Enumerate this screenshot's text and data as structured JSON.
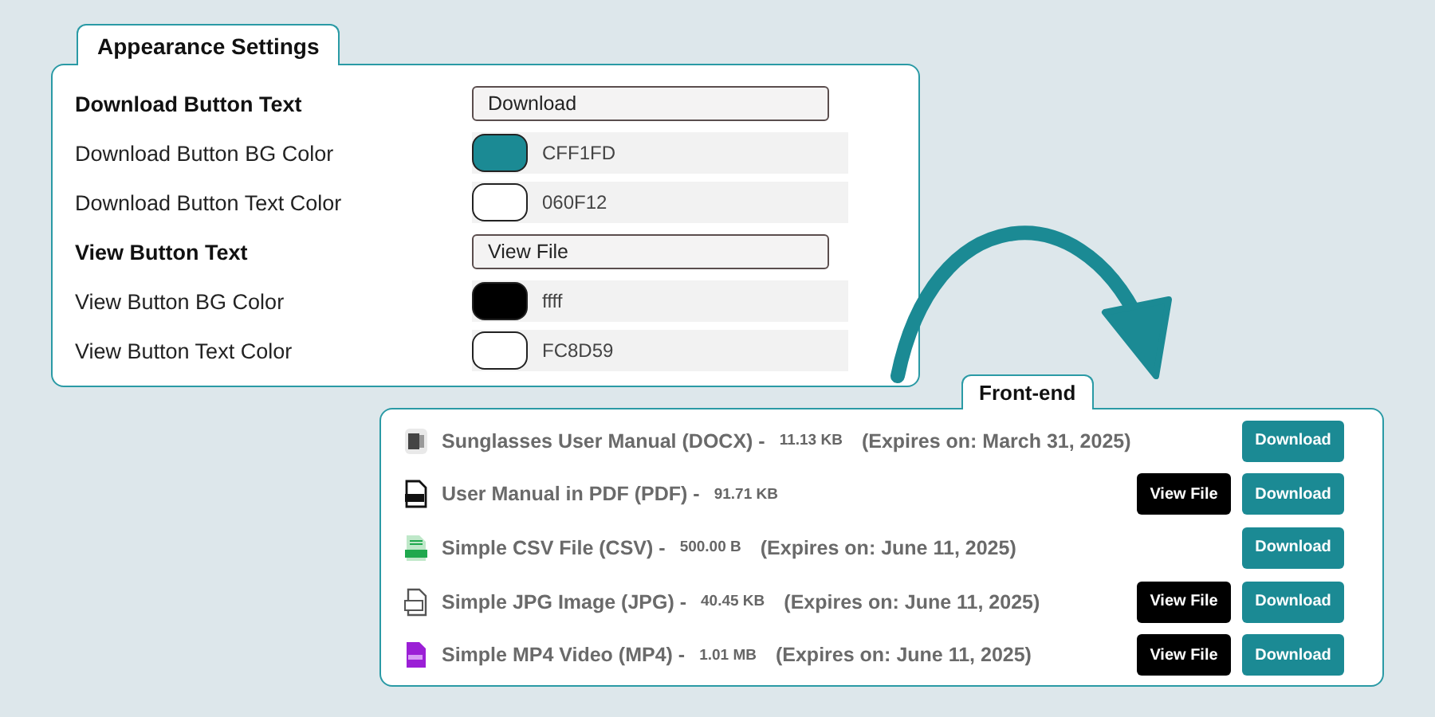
{
  "settings": {
    "tab": "Appearance Settings",
    "rows": [
      {
        "kind": "text",
        "label": "Download Button Text",
        "value": "Download"
      },
      {
        "kind": "color",
        "label": "Download Button BG Color",
        "color": "#1b8a94",
        "value": "CFF1FD"
      },
      {
        "kind": "color",
        "label": "Download Button Text Color",
        "color": "#ffffff",
        "value": "060F12"
      },
      {
        "kind": "text",
        "label": "View Button Text",
        "value": "View File"
      },
      {
        "kind": "color",
        "label": "View Button BG Color",
        "color": "#000000",
        "value": "ffff"
      },
      {
        "kind": "color",
        "label": "View Button Text Color",
        "color": "#ffffff",
        "value": "FC8D59"
      }
    ]
  },
  "frontend": {
    "tab": "Front-end",
    "files": [
      {
        "kind": "docx",
        "name": "Sunglasses User Manual (DOCX) -",
        "size": "11.13 KB",
        "expires": "(Expires on: March 31, 2025)",
        "download": "Download"
      },
      {
        "kind": "pdf",
        "name": "User Manual in PDF (PDF) -",
        "size": "91.71 KB",
        "view": "View File",
        "download": "Download"
      },
      {
        "kind": "csv",
        "name": "Simple CSV File (CSV) -",
        "size": "500.00 B",
        "expires": "(Expires on: June 11, 2025)",
        "download": "Download"
      },
      {
        "kind": "jpg",
        "name": "Simple JPG Image (JPG) -",
        "size": "40.45 KB",
        "expires": "(Expires on: June 11, 2025)",
        "view": "View File",
        "download": "Download"
      },
      {
        "kind": "mp4",
        "name": "Simple MP4 Video (MP4) -",
        "size": "1.01 MB",
        "expires": "(Expires on: June 11, 2025)",
        "view": "View File",
        "download": "Download"
      }
    ]
  }
}
